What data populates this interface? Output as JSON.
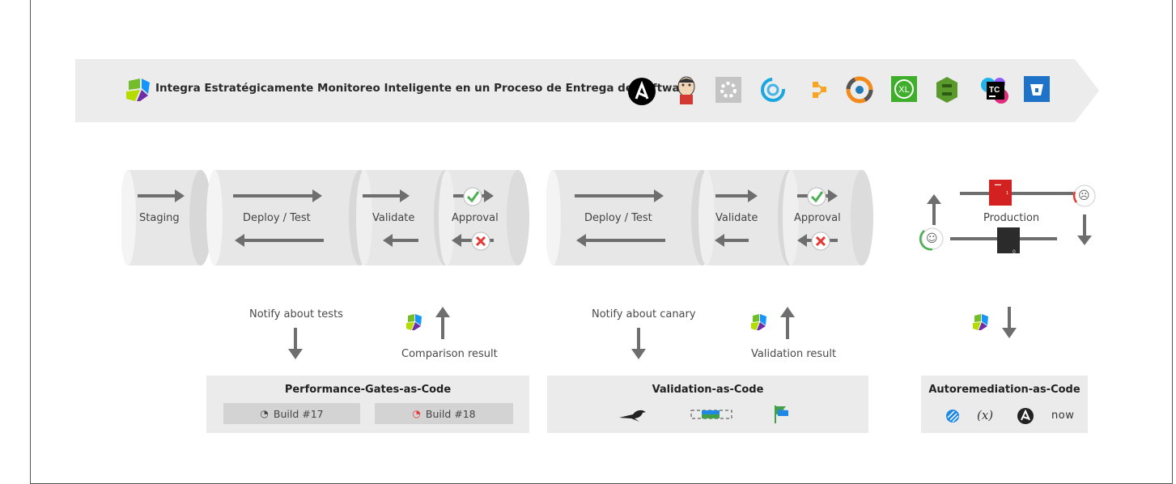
{
  "banner": {
    "title": "Integra Estratégicamente Monitoreo Inteligente en un Proceso de Entrega de Software",
    "tool_icons": [
      "ansible-icon",
      "jenkins-icon",
      "concourse-icon",
      "circleci-icon",
      "gitlab-icon",
      "xebialabs-icon",
      "xl-release-icon",
      "aws-codepipeline-icon",
      "teamcity-icon",
      "bitbucket-icon"
    ]
  },
  "pipeline1": {
    "stages": [
      "Staging",
      "Deploy / Test",
      "Validate",
      "Approval"
    ]
  },
  "pipeline2": {
    "stages": [
      "Deploy / Test",
      "Validate",
      "Approval"
    ]
  },
  "production": {
    "label": "Production",
    "badge_top": "1",
    "badge_bottom": "0"
  },
  "flows": {
    "notify_tests": "Notify about tests",
    "comparison_result": "Comparison result",
    "notify_canary": "Notify about canary",
    "validation_result": "Validation result"
  },
  "boxes": {
    "performance": {
      "title": "Performance-Gates-as-Code",
      "builds": [
        "Build #17",
        "Build #18"
      ]
    },
    "validation": {
      "title": "Validation-as-Code",
      "icons": [
        "bird-icon",
        "canary-bars-icon",
        "feature-flag-icon"
      ]
    },
    "autoremediation": {
      "title": "Autoremediation-as-Code",
      "icons": [
        "stackstorm-icon",
        "function-icon",
        "ansible-icon",
        "servicenow-icon"
      ],
      "servicenow_text": "now",
      "function_text": "(x)"
    }
  },
  "colors": {
    "banner_bg": "#ececec",
    "cylinder": "#e6e6e6",
    "arrow": "#6e6e6e",
    "ok_green": "#4caf50",
    "fail_red": "#e53935",
    "dynatrace_blue": "#1496ff"
  }
}
